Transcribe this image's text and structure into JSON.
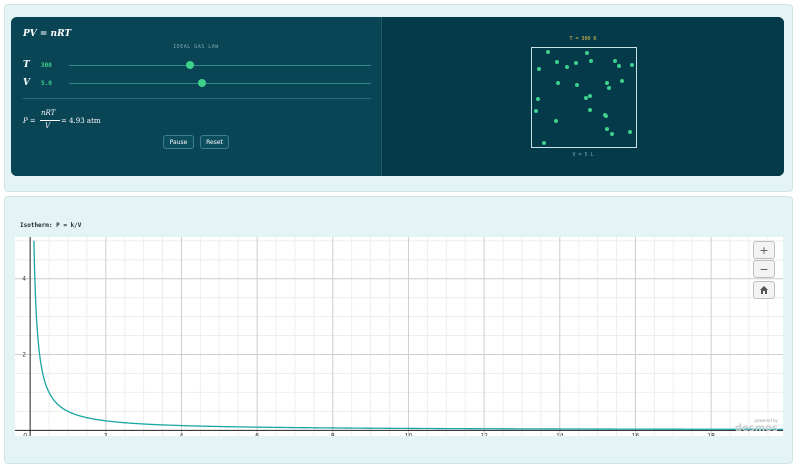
{
  "sim": {
    "formula": "PV = nRT",
    "subtitle": "IDEAL GAS LAW",
    "vars": [
      {
        "label": "T",
        "value": "300",
        "level": 0.4
      },
      {
        "label": "V",
        "value": "5.0",
        "level": 0.44
      }
    ],
    "pressure": {
      "lhs": "P =",
      "numerator": "nRT",
      "denominator": "V",
      "rhs": "= 4.93 atm"
    },
    "buttons": {
      "pause": "Pause",
      "reset": "Reset"
    },
    "temperature_label": "T = 300 K",
    "volume_label": "V = 5 L",
    "particle_color": "#3ed18c",
    "accent_color": "#e2c04a"
  },
  "graph": {
    "title": "Isotherm: P = k/V",
    "zoom": {
      "in": "+",
      "out": "−"
    },
    "branding": {
      "powered": "powered by",
      "logo": "desmos"
    },
    "curve_color": "#1aa5a0"
  },
  "chart_data": {
    "type": "line",
    "title": "Isotherm: P = k/V",
    "xlabel": "",
    "ylabel": "",
    "xlim": [
      -0.4,
      19.9
    ],
    "ylim": [
      -0.15,
      5.1
    ],
    "x_ticks": [
      "0",
      "2",
      "4",
      "6",
      "8",
      "10",
      "12",
      "14",
      "16",
      "18"
    ],
    "y_ticks": [
      "2",
      "4"
    ],
    "grid": true,
    "series": [
      {
        "function": "P = k/V",
        "k": 0.5,
        "x_start": 0.1,
        "x_end": 19.9
      }
    ]
  }
}
